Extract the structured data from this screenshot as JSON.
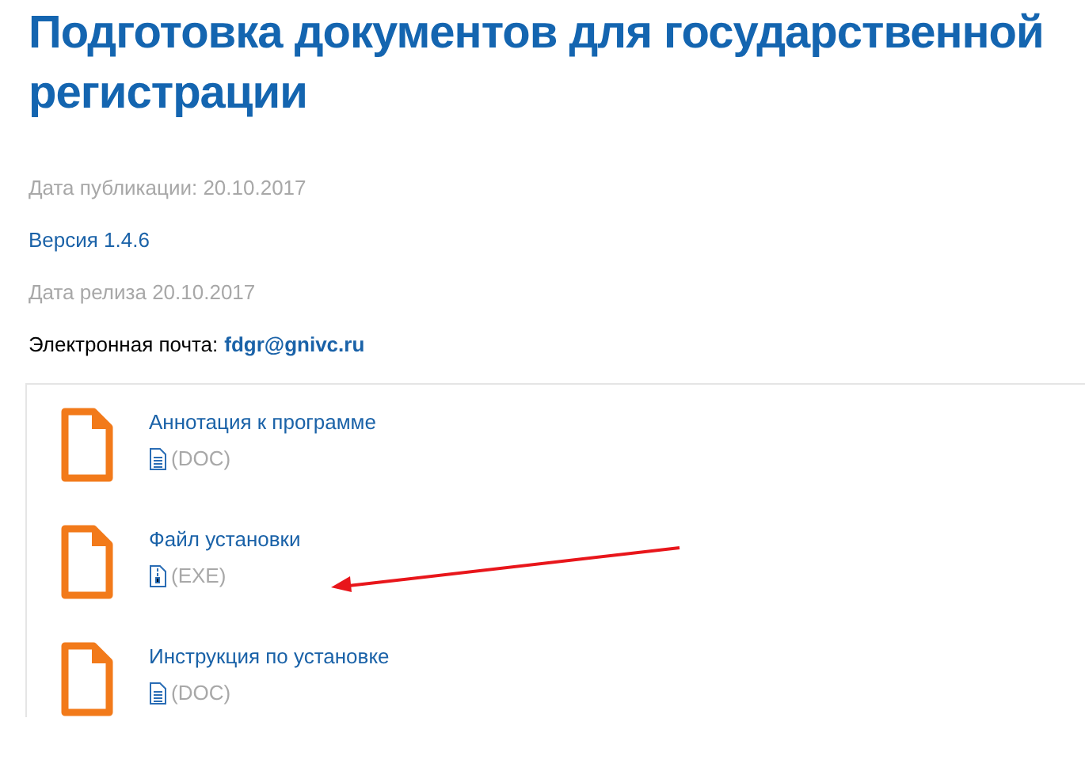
{
  "title": "Подготовка документов для государственной регистрации",
  "meta": [
    {
      "kind": "muted",
      "text": "Дата публикации: 20.10.2017"
    },
    {
      "kind": "link",
      "text": "Версия 1.4.6"
    },
    {
      "kind": "muted",
      "text": "Дата релиза 20.10.2017"
    },
    {
      "kind": "email",
      "label": "Электронная почта:",
      "value": "fdgr@gnivc.ru"
    }
  ],
  "files": [
    {
      "name": "Аннотация к программе",
      "kind": "doc",
      "format": "(DOC)",
      "highlighted": false
    },
    {
      "name": "Файл установки",
      "kind": "exe",
      "format": "(EXE)",
      "highlighted": true
    },
    {
      "name": "Инструкция по установке",
      "kind": "doc",
      "format": "(DOC)",
      "highlighted": false
    }
  ]
}
